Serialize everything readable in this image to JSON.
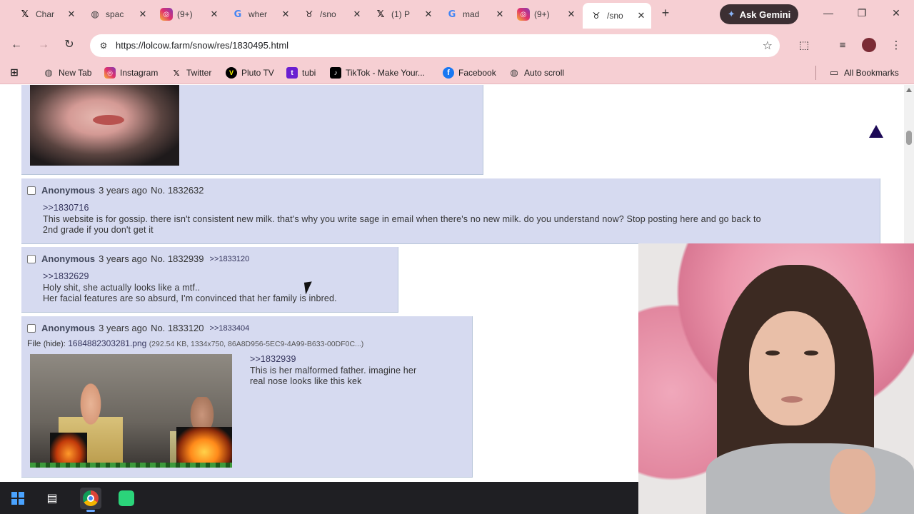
{
  "tabs": [
    {
      "icon": "x-icon",
      "title": "Char"
    },
    {
      "icon": "globe-icon",
      "title": "spac"
    },
    {
      "icon": "instagram-icon",
      "title": "(9+)"
    },
    {
      "icon": "google-icon",
      "title": "wher"
    },
    {
      "icon": "lolcow-icon",
      "title": "/sno"
    },
    {
      "icon": "x-icon",
      "title": "(1) P"
    },
    {
      "icon": "google-icon",
      "title": "mad"
    },
    {
      "icon": "instagram-icon",
      "title": "(9+)"
    },
    {
      "icon": "lolcow-icon",
      "title": "/sno",
      "active": true
    }
  ],
  "gemini_label": "Ask Gemini",
  "address": {
    "url": "https://lolcow.farm/snow/res/1830495.html"
  },
  "bookmarks": [
    {
      "label": "New Tab"
    },
    {
      "label": "Instagram"
    },
    {
      "label": "Twitter"
    },
    {
      "label": "Pluto TV"
    },
    {
      "label": "tubi"
    },
    {
      "label": "TikTok - Make Your..."
    },
    {
      "label": "Facebook"
    },
    {
      "label": "Auto scroll"
    }
  ],
  "all_bookmarks_label": "All Bookmarks",
  "posts": [
    {
      "name": "Anonymous",
      "time": "3 years ago",
      "no": "No. 1832632",
      "reply_link": "",
      "quote": ">>1830716",
      "lines": [
        "This website is for gossip. there isn't consistent new milk. that's why you write sage in email when there's no new milk. do you understand now? Stop posting here and go back to",
        "2nd grade if you don't get it"
      ]
    },
    {
      "name": "Anonymous",
      "time": "3 years ago",
      "no": "No. 1832939",
      "reply_link": ">>1833120",
      "quote": ">>1832629",
      "lines": [
        "Holy shit, she actually looks like a mtf..",
        "Her facial features are so absurd, I'm convinced that her family is inbred."
      ]
    },
    {
      "name": "Anonymous",
      "time": "3 years ago",
      "no": "No. 1833120",
      "reply_link": ">>1833404",
      "file_prefix": "File",
      "file_hide": "(hide):",
      "file_name": "1684882303281.png",
      "file_meta": "(292.54 KB, 1334x750, 86A8D956-5EC9-4A99-B633-00DF0C...)",
      "quote": ">>1832939",
      "lines": [
        "This is her malformed father. imagine her",
        "real nose looks like this kek"
      ]
    }
  ],
  "colors": {
    "chrome_pink": "#f6cfd3",
    "post_bg": "#d6daf0",
    "scroll_arrow": "#1d0a57",
    "taskbar": "#1f1f23"
  }
}
